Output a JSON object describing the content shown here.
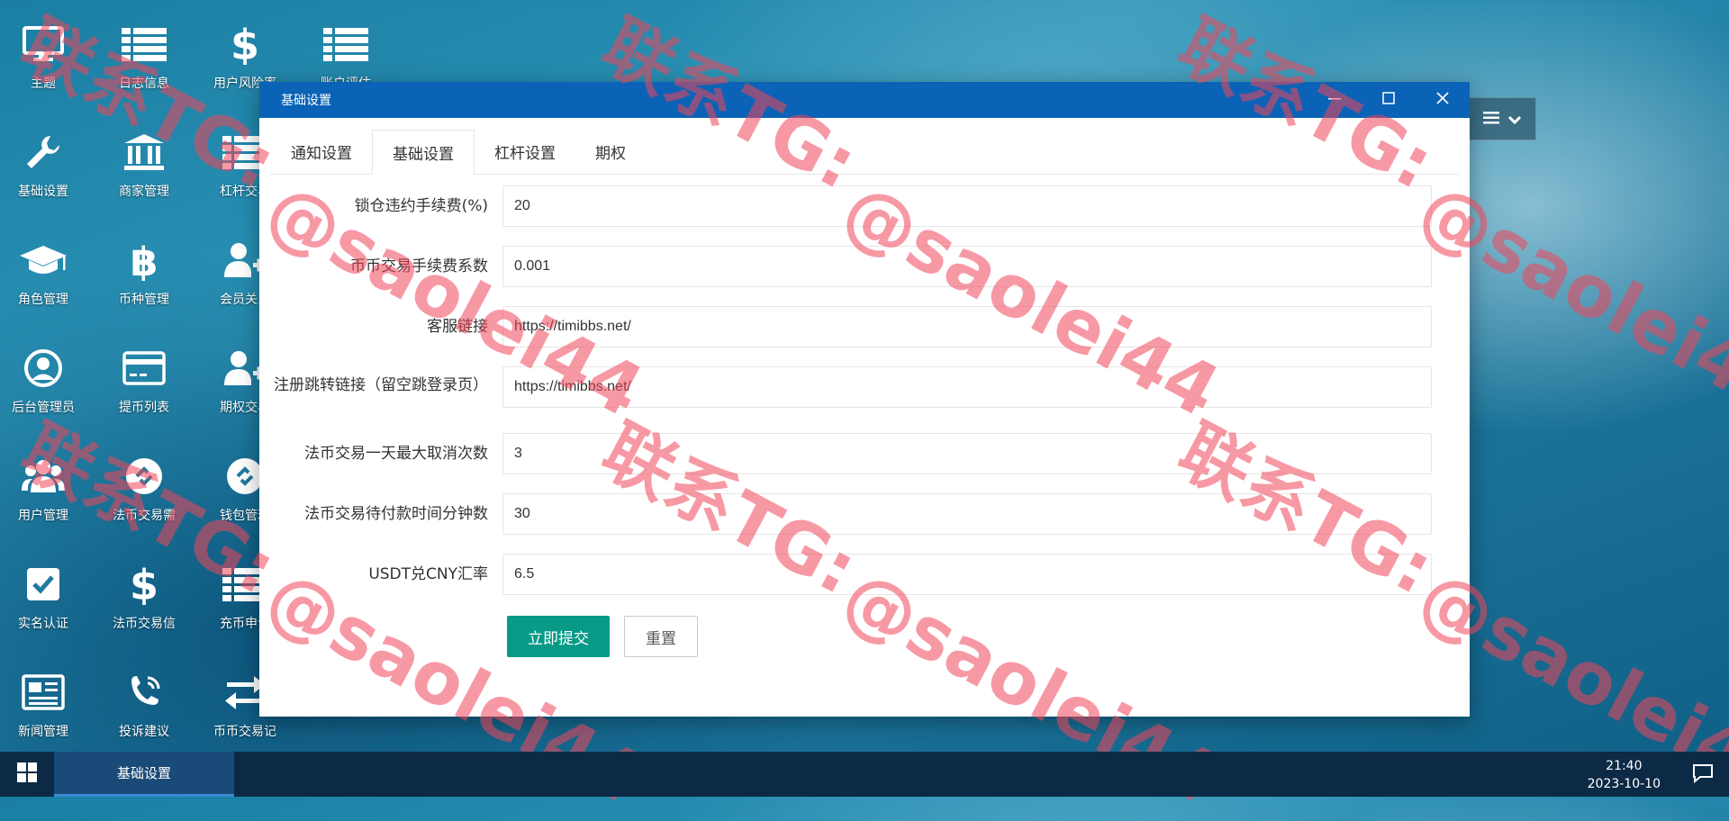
{
  "desktop": {
    "icons": [
      {
        "label": "主题",
        "icon": "monitor-icon"
      },
      {
        "label": "日志信息",
        "icon": "list-icon"
      },
      {
        "label": "用户风险率",
        "icon": "dollar-icon"
      },
      {
        "label": "账户评估",
        "icon": "list-icon"
      },
      {
        "label": "基础设置",
        "icon": "wrench-icon"
      },
      {
        "label": "商家管理",
        "icon": "bank-icon"
      },
      {
        "label": "杠杆交易",
        "icon": "list-icon"
      },
      {
        "label": "角色管理",
        "icon": "graduation-cap-icon"
      },
      {
        "label": "币种管理",
        "icon": "bitcoin-icon"
      },
      {
        "label": "会员关系",
        "icon": "user-plus-icon"
      },
      {
        "label": "后台管理员",
        "icon": "user-circle-icon"
      },
      {
        "label": "提币列表",
        "icon": "credit-card-icon"
      },
      {
        "label": "期权交易",
        "icon": "user-plus-icon"
      },
      {
        "label": "用户管理",
        "icon": "users-icon"
      },
      {
        "label": "法币交易需",
        "icon": "link-icon"
      },
      {
        "label": "钱包管理",
        "icon": "link-icon"
      },
      {
        "label": "实名认证",
        "icon": "checkbox-icon"
      },
      {
        "label": "法币交易信",
        "icon": "dollar-icon"
      },
      {
        "label": "充币申请",
        "icon": "list-icon"
      },
      {
        "label": "新闻管理",
        "icon": "newspaper-icon"
      },
      {
        "label": "投诉建议",
        "icon": "phone-icon"
      },
      {
        "label": "币币交易记",
        "icon": "exchange-icon"
      }
    ]
  },
  "window": {
    "title": "基础设置",
    "tabs": [
      {
        "label": "通知设置",
        "active": false
      },
      {
        "label": "基础设置",
        "active": true
      },
      {
        "label": "杠杆设置",
        "active": false
      },
      {
        "label": "期权",
        "active": false
      }
    ],
    "fields": [
      {
        "label": "锁仓违约手续费(%)",
        "value": "20"
      },
      {
        "label": "币币交易手续费系数",
        "value": "0.001"
      },
      {
        "label": "客服链接",
        "value": "https://timibbs.net/"
      },
      {
        "label": "注册跳转链接（留空跳登录页）",
        "value": "https://timibbs.net/"
      },
      {
        "label": "法币交易一天最大取消次数",
        "value": "3"
      },
      {
        "label": "法币交易待付款时间分钟数",
        "value": "30"
      },
      {
        "label": "USDT兑CNY汇率",
        "value": "6.5"
      }
    ],
    "submit_label": "立即提交",
    "reset_label": "重置"
  },
  "taskbar": {
    "active_item": "基础设置",
    "time": "21:40",
    "date": "2023-10-10"
  },
  "watermarks": {
    "contact": "联系TG:",
    "handle": "@saolei44"
  },
  "colors": {
    "titlebar": "#0a63b6",
    "primary_button": "#079a87",
    "taskbar": "#0c2a45",
    "watermark": "#f0465a"
  }
}
